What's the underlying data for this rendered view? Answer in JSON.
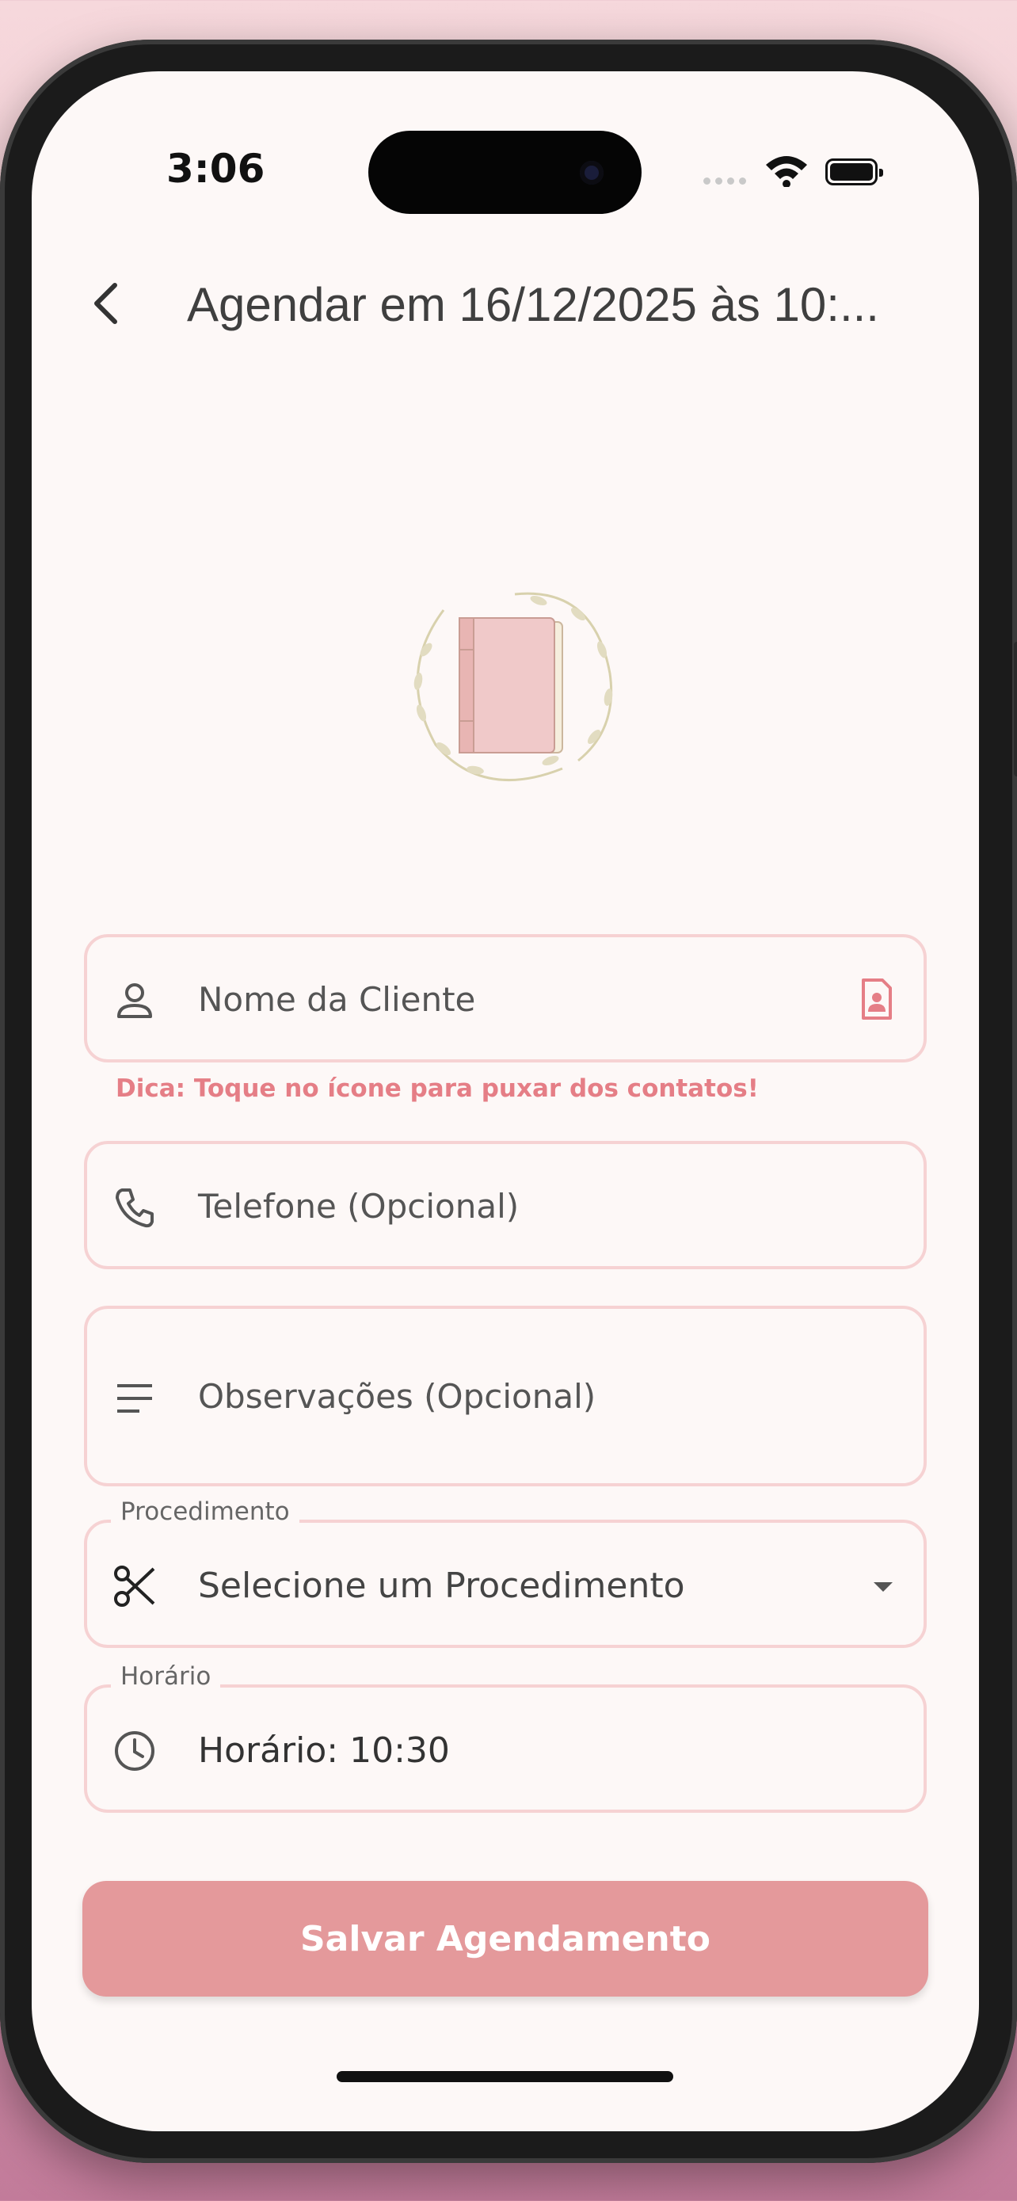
{
  "status_bar": {
    "time": "3:06"
  },
  "header": {
    "title": "Agendar em 16/12/2025 às 10:..."
  },
  "form": {
    "client_name": {
      "placeholder": "Nome da Cliente",
      "hint": "Dica: Toque no ícone para puxar dos contatos!"
    },
    "phone": {
      "placeholder": "Telefone (Opcional)"
    },
    "notes": {
      "placeholder": "Observações (Opcional)"
    },
    "procedure": {
      "label": "Procedimento",
      "selected": "Selecione um Procedimento"
    },
    "time": {
      "label": "Horário",
      "value": "Horário: 10:30"
    }
  },
  "actions": {
    "save_label": "Salvar Agendamento"
  },
  "colors": {
    "accent": "#e4999b",
    "border": "#f6d2d3",
    "hint": "#e57e86",
    "background": "#fdf8f7"
  },
  "icons": [
    "back-arrow-icon",
    "person-icon",
    "contact-card-icon",
    "phone-icon",
    "notes-icon",
    "scissors-icon",
    "dropdown-arrow-icon",
    "clock-icon",
    "wifi-icon",
    "battery-icon"
  ]
}
